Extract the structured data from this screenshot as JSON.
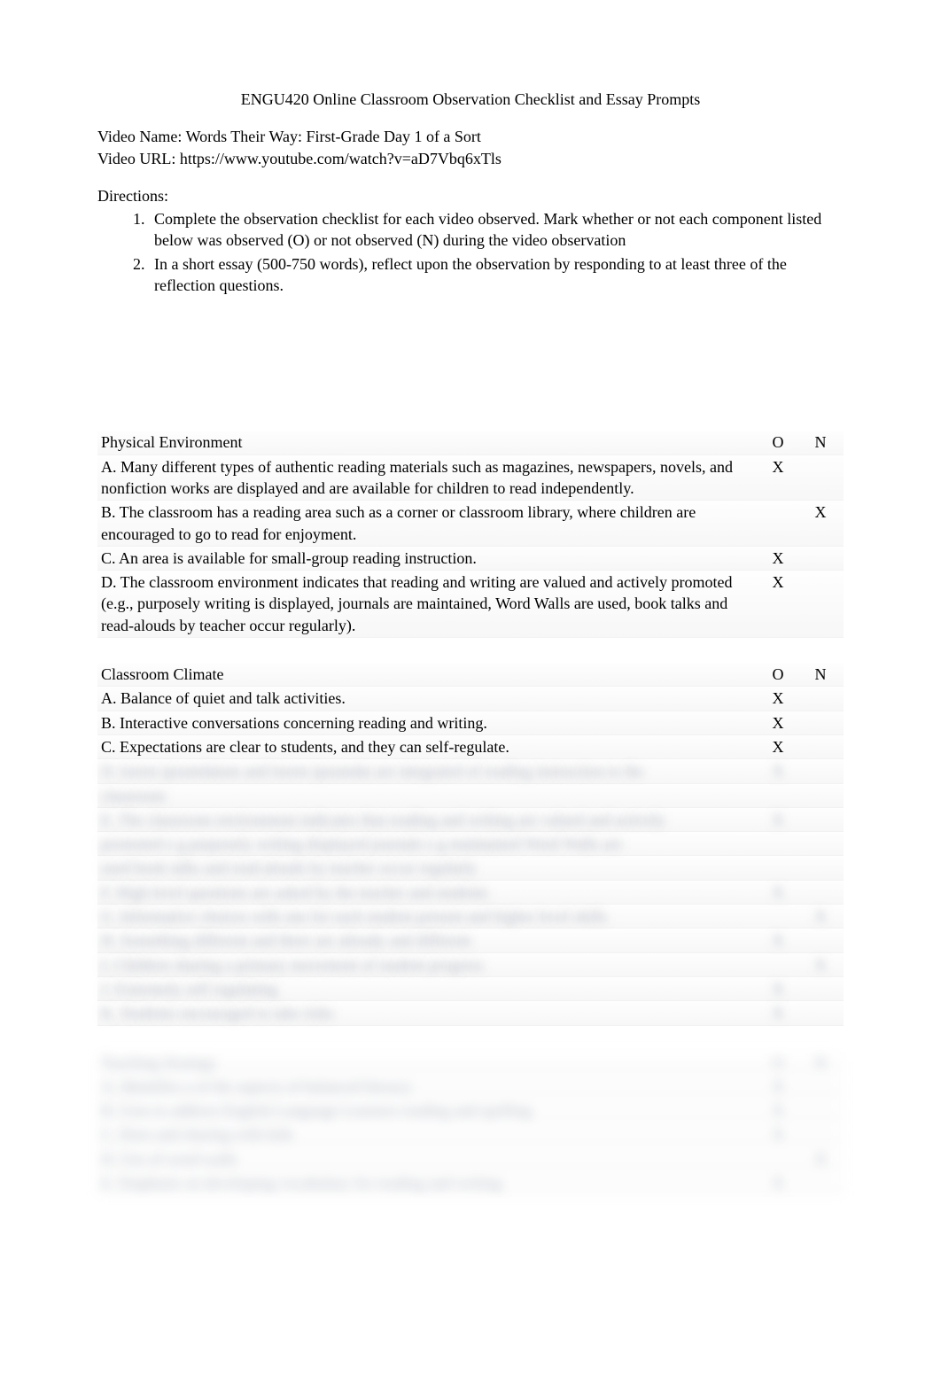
{
  "title": "ENGU420 Online Classroom Observation Checklist and Essay Prompts",
  "meta": {
    "video_name_label": "Video Name: ",
    "video_name": "Words Their Way: First-Grade Day 1 of a Sort",
    "video_url_label": "Video URL: ",
    "video_url": "https://www.youtube.com/watch?v=aD7Vbq6xTls"
  },
  "directions_label": "Directions:",
  "directions": [
    "Complete the observation checklist for each video observed. Mark whether or not each component listed below was observed (O)   or not observed (N) during the video observation",
    "In a short essay (500-750 words), reflect upon the observation by responding to at least three of the reflection questions."
  ],
  "sections": [
    {
      "heading": "Physical Environment",
      "o_header": "O",
      "n_header": "N",
      "rows": [
        {
          "label": "A. Many different types of authentic reading materials such as magazines, newspapers, novels, and nonfiction works are displayed and are available for children to read independently.",
          "o": "X",
          "n": ""
        },
        {
          "label": "B. The classroom has a reading area such as a corner or classroom library, where children are encouraged to go to read for enjoyment.",
          "o": "",
          "n": "X"
        },
        {
          "label": "C. An area is available for small-group reading instruction.",
          "o": "X",
          "n": ""
        },
        {
          "label": "D. The classroom environment indicates that reading and writing are valued and actively promoted (e.g., purposely writing is displayed, journals are maintained, Word Walls are used, book talks and read-alouds by teacher occur regularly).",
          "o": "X",
          "n": ""
        }
      ]
    },
    {
      "heading": "Classroom Climate",
      "o_header": "O",
      "n_header": "N",
      "rows": [
        {
          "label": "A. Balance of quiet and talk activities.",
          "o": "X",
          "n": ""
        },
        {
          "label": "B. Interactive conversations concerning reading and writing.",
          "o": "X",
          "n": ""
        },
        {
          "label": "C. Expectations are clear to students, and they can self-regulate.",
          "o": "X",
          "n": ""
        }
      ]
    }
  ]
}
